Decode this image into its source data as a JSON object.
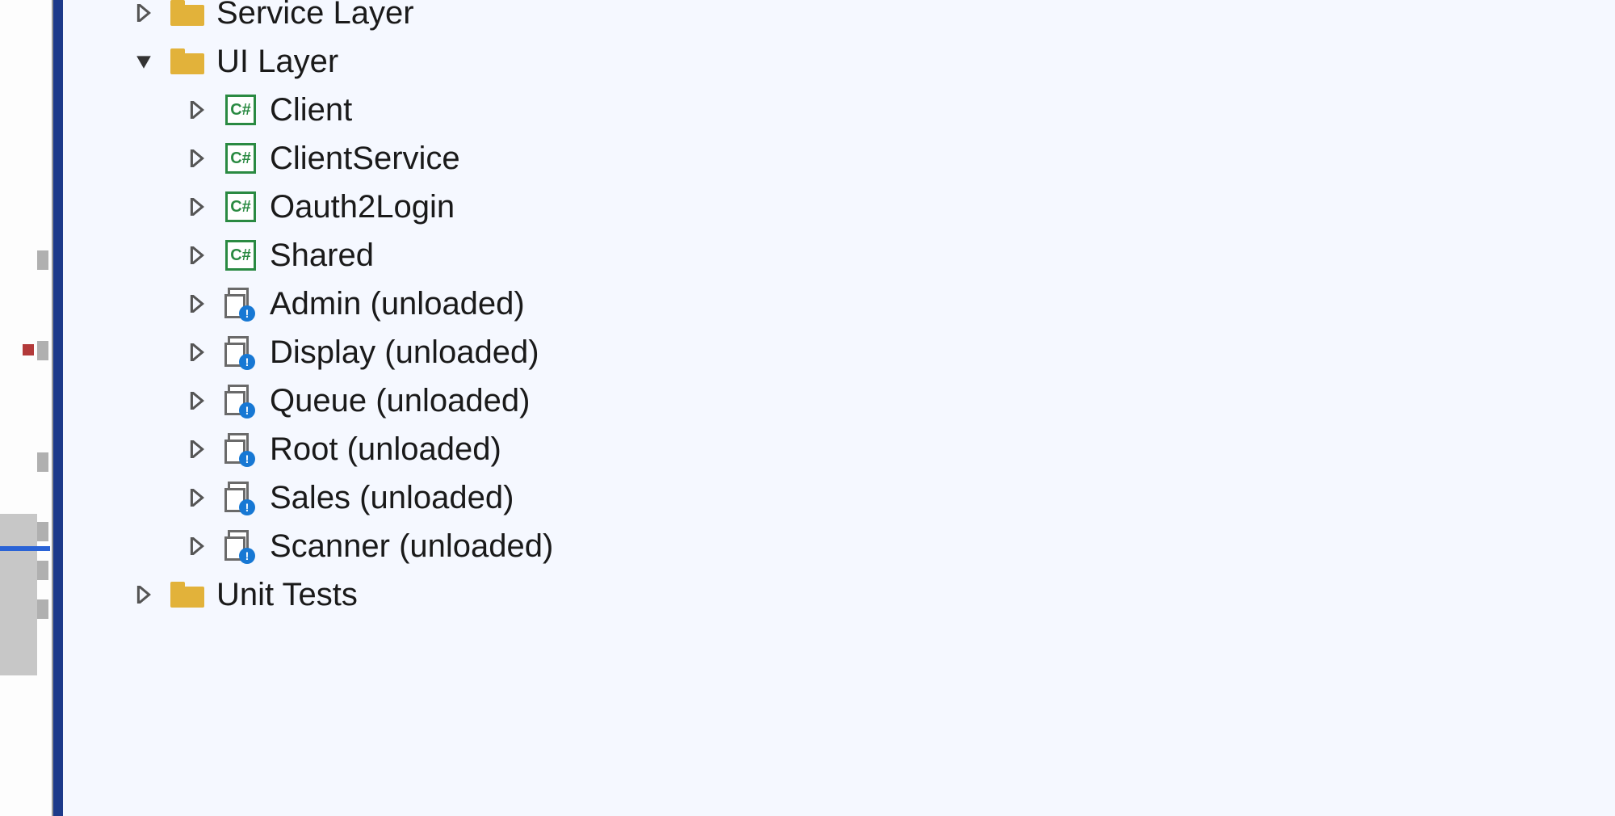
{
  "tree": {
    "service_layer": "Service Layer",
    "ui_layer": "UI Layer",
    "unit_tests": "Unit Tests",
    "ui_children": {
      "client": "Client",
      "client_service": "ClientService",
      "oauth2_login": "Oauth2Login",
      "shared": "Shared",
      "admin": "Admin (unloaded)",
      "display": "Display (unloaded)",
      "queue": "Queue (unloaded)",
      "root": "Root (unloaded)",
      "sales": "Sales (unloaded)",
      "scanner": "Scanner (unloaded)"
    },
    "cs_badge": "C#",
    "unl_badge": "!"
  }
}
